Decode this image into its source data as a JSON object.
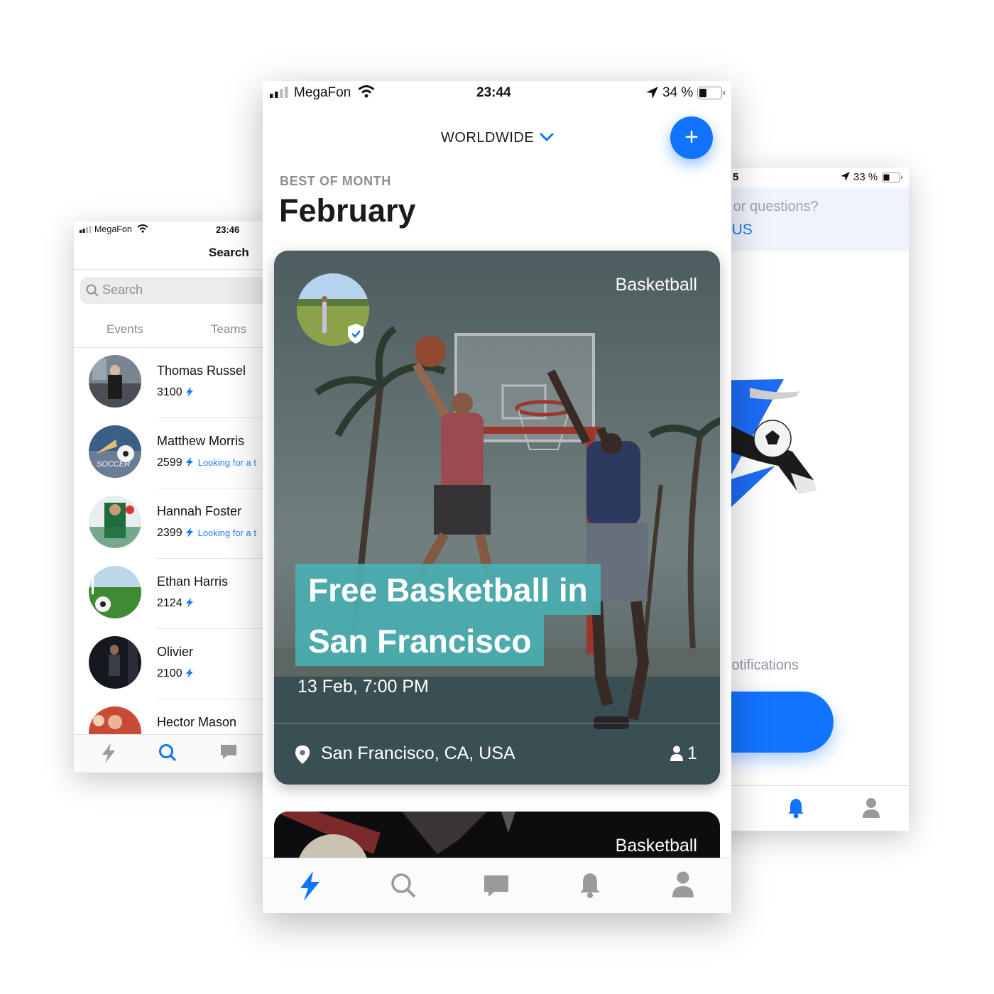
{
  "left_screen": {
    "status": {
      "carrier": "MegaFon",
      "time": "23:46"
    },
    "title": "Search",
    "search": {
      "placeholder": "Search"
    },
    "segments": [
      "Events",
      "Teams"
    ],
    "people": [
      {
        "name": "Thomas Russel",
        "score": "3100",
        "looking": ""
      },
      {
        "name": "Matthew Morris",
        "score": "2599",
        "looking": "Looking for a t"
      },
      {
        "name": "Hannah Foster",
        "score": "2399",
        "looking": "Looking for a t"
      },
      {
        "name": "Ethan Harris",
        "score": "2124",
        "looking": ""
      },
      {
        "name": "Olivier",
        "score": "2100",
        "looking": ""
      },
      {
        "name": "Hector Mason",
        "score": "",
        "looking": ""
      }
    ],
    "avatar_badge_text": "SOCCER",
    "tabs": [
      "bolt-icon",
      "search-icon",
      "chat-icon"
    ]
  },
  "center_screen": {
    "status": {
      "carrier": "MegaFon",
      "time": "23:44",
      "battery": "34 %"
    },
    "region": "WORLDWIDE",
    "fab_label": "+",
    "section_label": "BEST OF MONTH",
    "month": "February",
    "card": {
      "sport": "Basketball",
      "title_line1": "Free Basketball in",
      "title_line2": "San Francisco",
      "datetime": "13 Feb, 7:00 PM",
      "location": "San Francisco, CA, USA",
      "participants": "1"
    },
    "card2": {
      "sport": "Basketball"
    },
    "tabs": [
      "bolt-icon",
      "search-icon",
      "chat-icon",
      "bell-icon",
      "profile-icon"
    ]
  },
  "right_screen": {
    "status": {
      "time_partial": "5",
      "battery": "33 %"
    },
    "banner": {
      "question": "ack or questions?",
      "link": "TO US"
    },
    "notifications_text": "ur notifications",
    "tabs": [
      "bell-icon",
      "profile-icon"
    ]
  },
  "colors": {
    "accent": "#1273ff",
    "link": "#2a7cf6",
    "headline_bg": "#4aafb2",
    "muted": "#8d8d93"
  }
}
